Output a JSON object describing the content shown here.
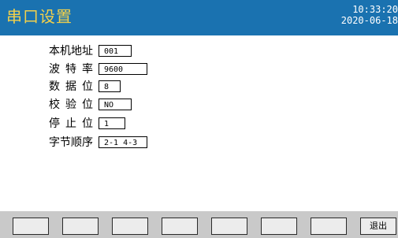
{
  "header": {
    "title": "串口设置",
    "time": "10:33:20",
    "date": "2020-06-18"
  },
  "settings": [
    {
      "label": "本机地址",
      "value": "001"
    },
    {
      "label": "波特率",
      "value": "9600"
    },
    {
      "label": "数据位",
      "value": "8"
    },
    {
      "label": "校验位",
      "value": "NO"
    },
    {
      "label": "停止位",
      "value": "1"
    },
    {
      "label": "字节顺序",
      "value": "2-1 4-3"
    }
  ],
  "footer": {
    "buttons": [
      "",
      "",
      "",
      "",
      "",
      "",
      "",
      "退出"
    ]
  },
  "colors": {
    "header_bg": "#1a72b0",
    "title": "#f2d04b",
    "footer_bg": "#c9c9c9"
  }
}
